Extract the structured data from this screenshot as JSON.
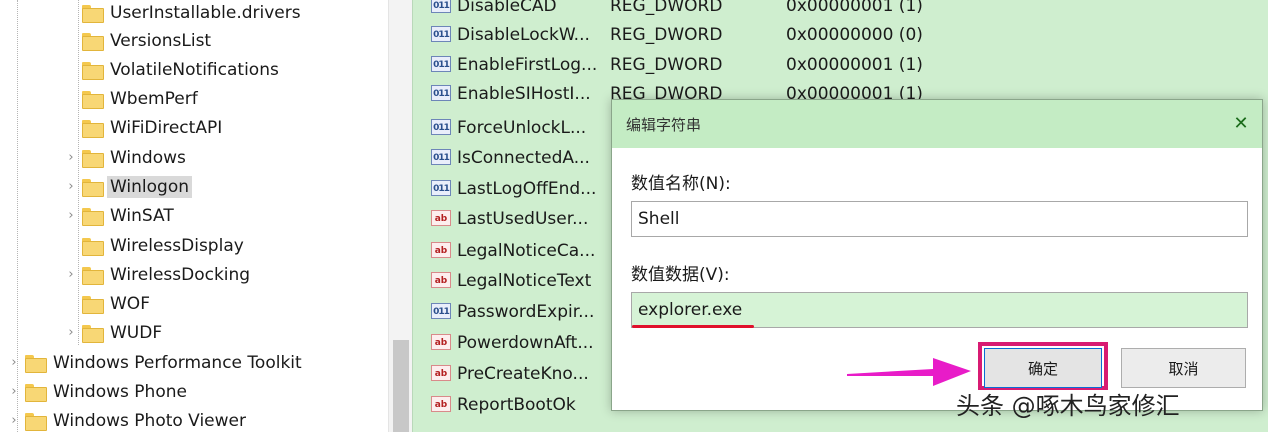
{
  "tree": {
    "rows": [
      {
        "label": "UserInstallable.drivers",
        "expander": ""
      },
      {
        "label": "VersionsList",
        "expander": ""
      },
      {
        "label": "VolatileNotifications",
        "expander": ""
      },
      {
        "label": "WbemPerf",
        "expander": ""
      },
      {
        "label": "WiFiDirectAPI",
        "expander": ""
      },
      {
        "label": "Windows",
        "expander": "›"
      },
      {
        "label": "Winlogon",
        "expander": "›"
      },
      {
        "label": "WinSAT",
        "expander": "›"
      },
      {
        "label": "WirelessDisplay",
        "expander": ""
      },
      {
        "label": "WirelessDocking",
        "expander": "›"
      },
      {
        "label": "WOF",
        "expander": ""
      },
      {
        "label": "WUDF",
        "expander": "›"
      },
      {
        "label": "Windows Performance Toolkit",
        "expander": "›"
      },
      {
        "label": "Windows Phone",
        "expander": "›"
      },
      {
        "label": "Windows Photo Viewer",
        "expander": "›"
      }
    ]
  },
  "values": {
    "rows": [
      {
        "name": "DisableCAD",
        "type": "REG_DWORD",
        "data": "0x00000001 (1)",
        "icon": "binary"
      },
      {
        "name": "DisableLockW...",
        "type": "REG_DWORD",
        "data": "0x00000000 (0)",
        "icon": "binary"
      },
      {
        "name": "EnableFirstLog...",
        "type": "REG_DWORD",
        "data": "0x00000001 (1)",
        "icon": "binary"
      },
      {
        "name": "EnableSIHostI...",
        "type": "REG_DWORD",
        "data": "0x00000001 (1)",
        "icon": "binary"
      },
      {
        "name": "ForceUnlockL...",
        "type": "",
        "data": "",
        "icon": "binary"
      },
      {
        "name": "IsConnectedA...",
        "type": "",
        "data": "",
        "icon": "binary"
      },
      {
        "name": "LastLogOffEnd...",
        "type": "",
        "data": "",
        "icon": "binary"
      },
      {
        "name": "LastUsedUser...",
        "type": "",
        "data": "",
        "icon": "string"
      },
      {
        "name": "LegalNoticeCa...",
        "type": "",
        "data": "",
        "icon": "string"
      },
      {
        "name": "LegalNoticeText",
        "type": "",
        "data": "",
        "icon": "string"
      },
      {
        "name": "PasswordExpir...",
        "type": "",
        "data": "",
        "icon": "binary"
      },
      {
        "name": "PowerdownAft...",
        "type": "",
        "data": "",
        "icon": "string"
      },
      {
        "name": "PreCreateKno...",
        "type": "",
        "data": "",
        "icon": "string"
      },
      {
        "name": "ReportBootOk",
        "type": "",
        "data": "",
        "icon": "string"
      }
    ]
  },
  "dialog": {
    "title": "编辑字符串",
    "close_glyph": "✕",
    "name_label": "数值名称(N):",
    "name_value": "Shell",
    "data_label": "数值数据(V):",
    "data_value": "explorer.exe",
    "ok_label": "确定",
    "cancel_label": "取消"
  },
  "watermark": "头条 @啄木鸟家修汇",
  "colors": {
    "values_bg": "#cfeecf",
    "dialog_titlebar": "#c4ecc4",
    "data_input_bg": "#d6f3d6",
    "highlight_pink": "#d81b73",
    "underline_red": "#e0102c",
    "arrow_magenta": "#e81cc8"
  }
}
